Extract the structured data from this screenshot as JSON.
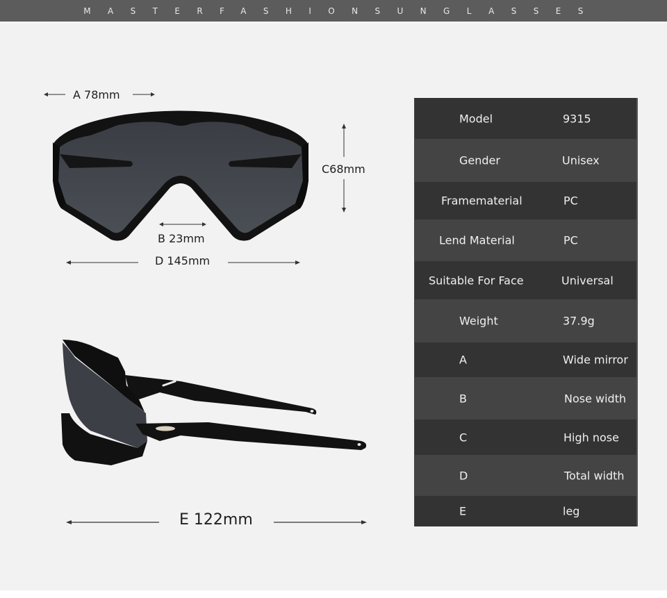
{
  "header": {
    "brand": "MASTERFASHIONSUNGLASSES"
  },
  "front_view": {
    "dim_a": "A 78mm",
    "dim_b": "B 23mm",
    "dim_c": "C68mm",
    "dim_d": "D 145mm"
  },
  "side_view": {
    "dim_e": "E 122mm"
  },
  "specs": [
    {
      "label": "Model",
      "value": "9315"
    },
    {
      "label": "Gender",
      "value": "Unisex"
    },
    {
      "label": "Framematerial",
      "value": "PC"
    },
    {
      "label": "Lend Material",
      "value": "PC"
    },
    {
      "label": "Suitable For Face",
      "value": "Universal"
    },
    {
      "label": "Weight",
      "value": "37.9g"
    },
    {
      "label": "A",
      "value": "Wide mirror"
    },
    {
      "label": "B",
      "value": "Nose width"
    },
    {
      "label": "C",
      "value": "High nose"
    },
    {
      "label": "D",
      "value": "Total width"
    },
    {
      "label": "E",
      "value": "leg"
    }
  ],
  "colors": {
    "header_bg": "#5c5c5c",
    "page_bg": "#f2f2f2",
    "row_dark": "#333333",
    "row_light": "#444444",
    "lens": "#3f4348",
    "frame": "#111111"
  }
}
